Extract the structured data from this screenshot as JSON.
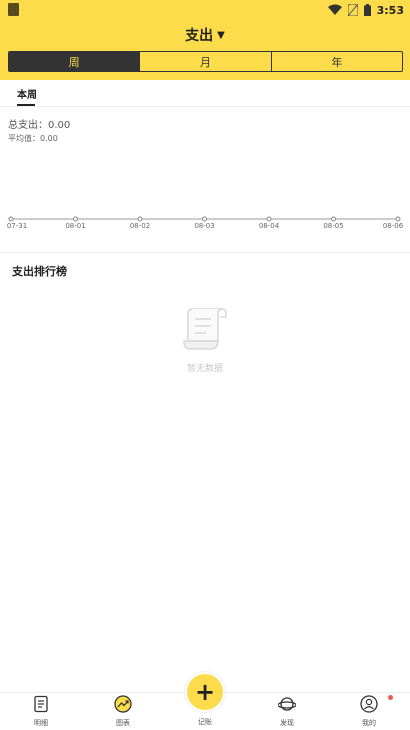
{
  "status_bar": {
    "time": "3:53"
  },
  "header": {
    "title": "支出",
    "title_caret": "▼",
    "period_tabs": [
      {
        "label": "周",
        "active": true
      },
      {
        "label": "月",
        "active": false
      },
      {
        "label": "年",
        "active": false
      }
    ]
  },
  "subtab": {
    "label": "本周"
  },
  "summary": {
    "total_label": "总支出：",
    "total_value": "0.00",
    "average_label": "平均值：",
    "average_value": "0.00"
  },
  "chart_data": {
    "type": "line",
    "categories": [
      "07-31",
      "08-01",
      "08-02",
      "08-03",
      "08-04",
      "08-05",
      "08-06"
    ],
    "series": [
      {
        "values": [
          0,
          0,
          0,
          0,
          0,
          0,
          0
        ]
      }
    ],
    "title": "",
    "xlabel": "",
    "ylabel": ""
  },
  "ranking": {
    "title": "支出排行榜",
    "empty_text": "暂无数据"
  },
  "tabbar": {
    "items": [
      {
        "label": "明细",
        "icon": "list-icon"
      },
      {
        "label": "图表",
        "icon": "chart-icon"
      },
      {
        "label": "记账",
        "icon": "plus-icon"
      },
      {
        "label": "发现",
        "icon": "planet-icon"
      },
      {
        "label": "我的",
        "icon": "user-icon"
      }
    ],
    "fab_symbol": "+"
  },
  "colors": {
    "accent": "#fcdc4a",
    "dark": "#333333",
    "badge": "#f05a4a"
  }
}
